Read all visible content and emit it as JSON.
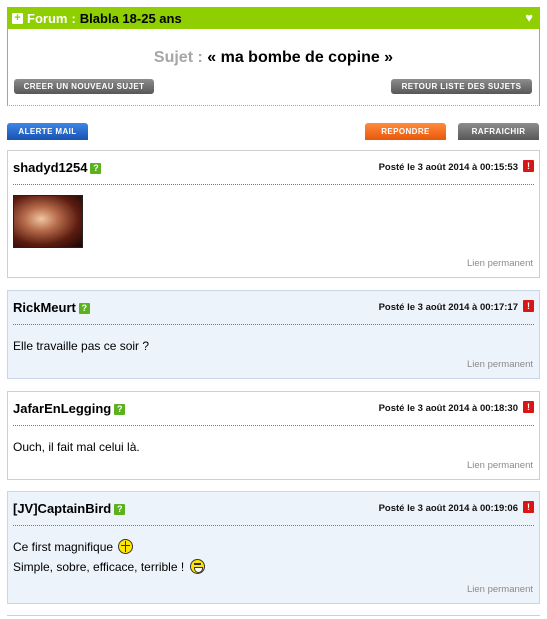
{
  "forum": {
    "label": "Forum",
    "separator": ":",
    "name": "Blabla 18-25 ans",
    "subject_label": "Sujet :",
    "subject_title": "« ma bombe de copine »",
    "new_topic_button": "Creer un nouveau sujet",
    "back_button": "Retour liste des sujets"
  },
  "actions": {
    "mail_alert": "Alerte mail",
    "reply": "Repondre",
    "refresh": "Rafraichir"
  },
  "posts": [
    {
      "author": "shadyd1254",
      "date": "Posté le 3 août 2014 à 00:15:53",
      "lines": [],
      "has_image": true,
      "permalink": "Lien permanent"
    },
    {
      "author": "RickMeurt",
      "date": "Posté le 3 août 2014 à 00:17:17",
      "lines": [
        "Elle travaille pas ce soir ?"
      ],
      "permalink": "Lien permanent"
    },
    {
      "author": "JafarEnLegging",
      "date": "Posté le 3 août 2014 à 00:18:30",
      "lines": [
        "Ouch, il fait mal celui là."
      ],
      "permalink": "Lien permanent"
    },
    {
      "author": "[JV]CaptainBird",
      "date": "Posté le 3 août 2014 à 00:19:06",
      "lines": [
        "Ce first magnifique",
        "Simple, sobre, efficace, terrible !"
      ],
      "permalink": "Lien permanent"
    }
  ],
  "icons": {
    "expand": "plus-icon",
    "favorite": "heart-icon",
    "profile": "profile-icon",
    "report": "alert-icon",
    "smiley_1": "smiley-cross-icon",
    "smiley_2": "smiley-laugh-icon"
  },
  "colors": {
    "forum_green": "#8fce00",
    "mail_blue": "#2a6fd3",
    "reply_orange": "#f46e1e",
    "gray_button": "#6f6f6f",
    "alt_post_bg": "#edf3fa",
    "report_red": "#d91616",
    "profile_green": "#5ab21d"
  }
}
